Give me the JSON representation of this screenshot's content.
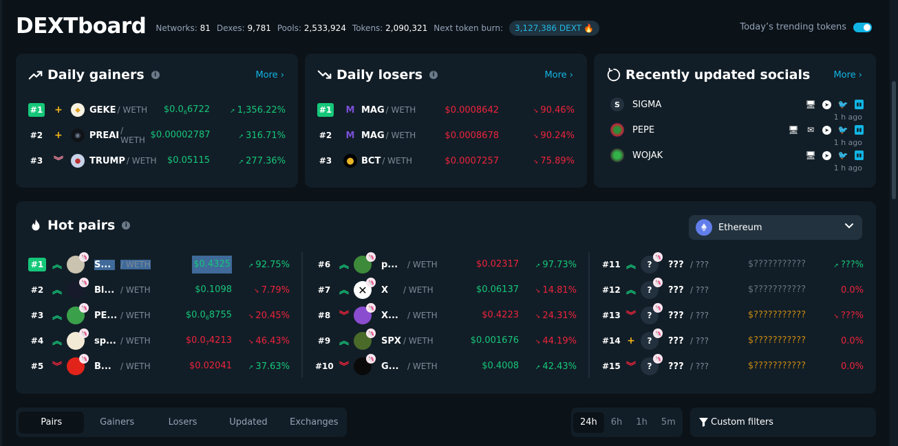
{
  "header": {
    "logo": "DEXTboard",
    "stats": [
      {
        "label": "Networks:",
        "value": "81"
      },
      {
        "label": "Dexes:",
        "value": "9,781"
      },
      {
        "label": "Pools:",
        "value": "2,533,924"
      },
      {
        "label": "Tokens:",
        "value": "2,090,321"
      }
    ],
    "burn_label": "Next token burn:",
    "burn_value": "3,127,386 DEXT",
    "trending_label": "Today’s trending tokens",
    "trending_enabled": true
  },
  "gainers": {
    "title": "Daily gainers",
    "more": "More ›",
    "rows": [
      {
        "rank": "#1",
        "trend": "new",
        "symbol": "GEKE",
        "quote": "/ WETH",
        "price_pre": "$0.0",
        "price_sub": "6",
        "price_post": "6722",
        "change": "1,356.22%"
      },
      {
        "rank": "#2",
        "trend": "new",
        "symbol": "PREAI",
        "quote": "/ WETH",
        "price_pre": "$0.00002787",
        "price_sub": "",
        "price_post": "",
        "change": "316.71%"
      },
      {
        "rank": "#3",
        "trend": "down",
        "symbol": "TRUMP",
        "quote": "/ WETH",
        "price_pre": "$0.05115",
        "price_sub": "",
        "price_post": "",
        "change": "277.36%"
      }
    ]
  },
  "losers": {
    "title": "Daily losers",
    "more": "More ›",
    "rows": [
      {
        "rank": "#1",
        "symbol": "MAG",
        "quote": "/ WETH",
        "price": "$0.0008642",
        "change": "90.46%"
      },
      {
        "rank": "#2",
        "symbol": "MAG",
        "quote": "/ WETH",
        "price": "$0.0008678",
        "change": "90.24%"
      },
      {
        "rank": "#3",
        "symbol": "BCT",
        "quote": "/ WETH",
        "price": "$0.0007257",
        "change": "75.89%"
      }
    ]
  },
  "socials": {
    "title": "Recently updated socials",
    "more": "More ›",
    "rows": [
      {
        "avatar": "S",
        "name": "SIGMA",
        "links": [
          "website",
          "telegram",
          "twitter",
          "dextools"
        ],
        "time": "1 h ago"
      },
      {
        "avatar": "",
        "name": "PEPE",
        "links": [
          "website",
          "email",
          "telegram",
          "twitter",
          "dextools"
        ],
        "time": "1 h ago"
      },
      {
        "avatar": "",
        "name": "WOJAK",
        "links": [
          "website",
          "telegram",
          "twitter",
          "dextools"
        ],
        "time": "1 h ago"
      }
    ]
  },
  "hot_pairs": {
    "title": "Hot pairs",
    "network": "Ethereum",
    "rows": [
      {
        "rank": "#1",
        "trend": "up",
        "symbol": "S...",
        "quote": "/ WETH",
        "price_pre": "$0.4325",
        "price_sub": "",
        "price_post": "",
        "price_color": "green",
        "change": "92.75%",
        "change_dir": "up"
      },
      {
        "rank": "#2",
        "trend": "up",
        "symbol": "Bl...",
        "quote": "/ WETH",
        "price_pre": "$0.1098",
        "price_sub": "",
        "price_post": "",
        "price_color": "green",
        "change": "7.79%",
        "change_dir": "down"
      },
      {
        "rank": "#3",
        "trend": "up",
        "symbol": "PE...",
        "quote": "/ WETH",
        "price_pre": "$0.0",
        "price_sub": "6",
        "price_post": "8755",
        "price_color": "green",
        "change": "20.45%",
        "change_dir": "down"
      },
      {
        "rank": "#4",
        "trend": "up",
        "symbol": "sp...",
        "quote": "/ WETH",
        "price_pre": "$0.0",
        "price_sub": "7",
        "price_post": "4213",
        "price_color": "red",
        "change": "46.43%",
        "change_dir": "down"
      },
      {
        "rank": "#5",
        "trend": "down",
        "symbol": "B...",
        "quote": "/ WETH",
        "price_pre": "$0.02041",
        "price_sub": "",
        "price_post": "",
        "price_color": "red",
        "change": "37.63%",
        "change_dir": "up"
      },
      {
        "rank": "#6",
        "trend": "up",
        "symbol": "p...",
        "quote": "/ WETH",
        "price_pre": "$0.02317",
        "price_sub": "",
        "price_post": "",
        "price_color": "red",
        "change": "97.73%",
        "change_dir": "up"
      },
      {
        "rank": "#7",
        "trend": "up",
        "symbol": "X",
        "quote": "/ WETH",
        "price_pre": "$0.06137",
        "price_sub": "",
        "price_post": "",
        "price_color": "green",
        "change": "14.81%",
        "change_dir": "down"
      },
      {
        "rank": "#8",
        "trend": "down",
        "symbol": "X...",
        "quote": "/ WETH",
        "price_pre": "$0.4223",
        "price_sub": "",
        "price_post": "",
        "price_color": "red",
        "change": "24.31%",
        "change_dir": "down"
      },
      {
        "rank": "#9",
        "trend": "up",
        "symbol": "SPX",
        "quote": "/ WETH",
        "price_pre": "$0.001676",
        "price_sub": "",
        "price_post": "",
        "price_color": "green",
        "change": "44.19%",
        "change_dir": "down"
      },
      {
        "rank": "#10",
        "trend": "down",
        "symbol": "G...",
        "quote": "/ WETH",
        "price_pre": "$0.4008",
        "price_sub": "",
        "price_post": "",
        "price_color": "green",
        "change": "42.43%",
        "change_dir": "up"
      },
      {
        "rank": "#11",
        "trend": "up",
        "symbol": "???",
        "quote": "/ ???",
        "price_pre": "$???????????",
        "price_sub": "",
        "price_post": "",
        "price_color": "grey",
        "change": "???%",
        "change_dir": "up"
      },
      {
        "rank": "#12",
        "trend": "up",
        "symbol": "???",
        "quote": "/ ???",
        "price_pre": "$???????????",
        "price_sub": "",
        "price_post": "",
        "price_color": "grey",
        "change": "0.0%",
        "change_dir": "none"
      },
      {
        "rank": "#13",
        "trend": "down",
        "symbol": "???",
        "quote": "/ ???",
        "price_pre": "$???????????",
        "price_sub": "",
        "price_post": "",
        "price_color": "gold",
        "change": "???%",
        "change_dir": "down"
      },
      {
        "rank": "#14",
        "trend": "new",
        "symbol": "???",
        "quote": "/ ???",
        "price_pre": "$???????????",
        "price_sub": "",
        "price_post": "",
        "price_color": "gold",
        "change": "0.0%",
        "change_dir": "none"
      },
      {
        "rank": "#15",
        "trend": "down",
        "symbol": "???",
        "quote": "/ ???",
        "price_pre": "$???????????",
        "price_sub": "",
        "price_post": "",
        "price_color": "gold",
        "change": "0.0%",
        "change_dir": "none"
      }
    ]
  },
  "bottom": {
    "tabs": [
      "Pairs",
      "Gainers",
      "Losers",
      "Updated",
      "Exchanges"
    ],
    "active_tab": "Pairs",
    "time_tabs": [
      "24h",
      "6h",
      "1h",
      "5m"
    ],
    "active_time": "24h",
    "filters_label": "Custom filters"
  },
  "colors": {
    "accent": "#11b5e4",
    "positive": "#16c77a",
    "negative": "#ef233c",
    "background": "#0b1218",
    "card": "#121e27"
  }
}
